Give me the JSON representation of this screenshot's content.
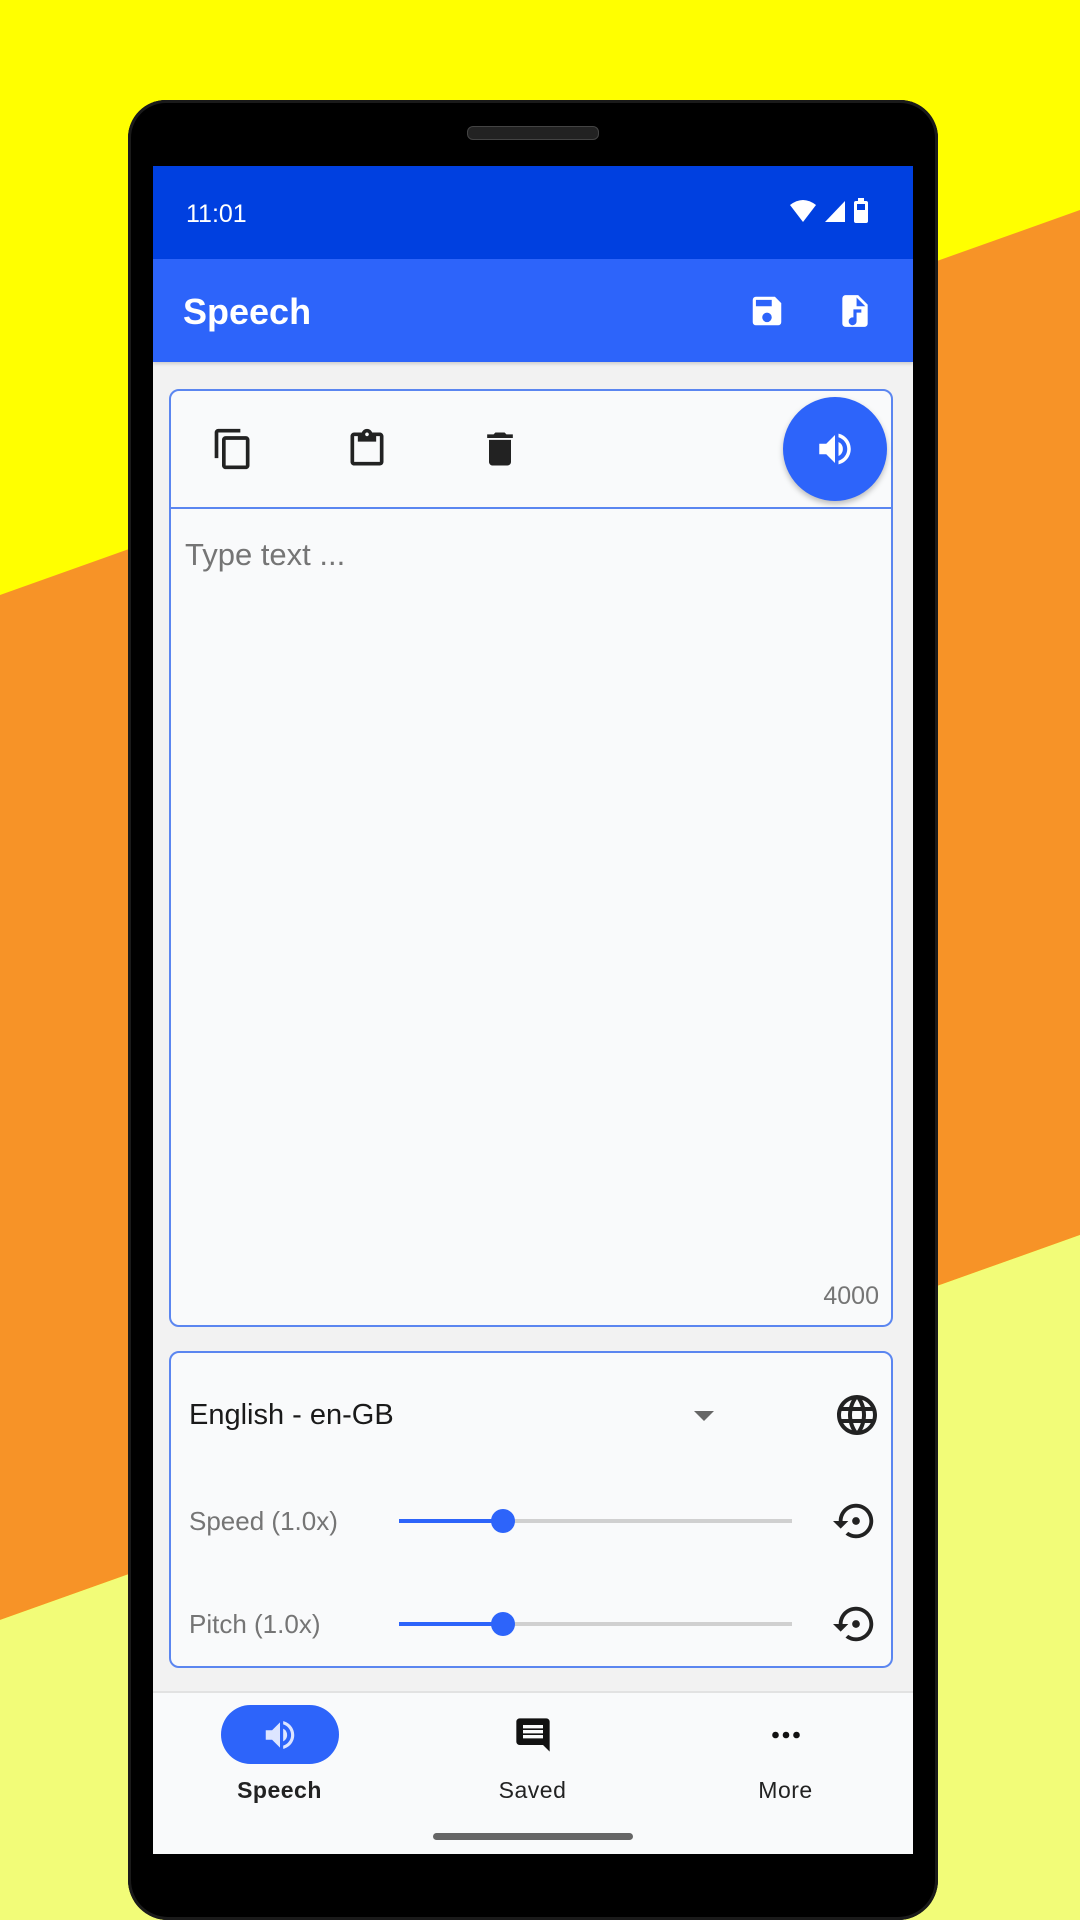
{
  "status_bar": {
    "time": "11:01",
    "icons": [
      "wifi-icon",
      "cellular-signal-icon",
      "battery-charging-icon"
    ]
  },
  "app_bar": {
    "title": "Speech",
    "actions": [
      {
        "name": "save-icon",
        "label": "Save"
      },
      {
        "name": "audio-file-icon",
        "label": "Export audio file"
      }
    ]
  },
  "text_card": {
    "toolbar": [
      {
        "name": "copy-icon",
        "label": "Copy"
      },
      {
        "name": "paste-icon",
        "label": "Paste"
      },
      {
        "name": "delete-icon",
        "label": "Clear"
      }
    ],
    "speak_button_icon": "volume-up-icon",
    "text_value": "",
    "placeholder": "Type text ...",
    "char_counter": "4000"
  },
  "voice_settings": {
    "language": {
      "selected": "English - en-GB",
      "icon": "globe-icon"
    },
    "speed": {
      "label": "Speed (1.0x)",
      "value": 1.0,
      "position_fraction": 0.265,
      "reset_icon": "restore-icon"
    },
    "pitch": {
      "label": "Pitch (1.0x)",
      "value": 1.0,
      "position_fraction": 0.265,
      "reset_icon": "restore-icon"
    }
  },
  "bottom_nav": {
    "items": [
      {
        "label": "Speech",
        "icon": "volume-up-icon",
        "active": true
      },
      {
        "label": "Saved",
        "icon": "chat-message-icon",
        "active": false
      },
      {
        "label": "More",
        "icon": "more-horizontal-icon",
        "active": false
      }
    ]
  },
  "colors": {
    "status_bar": "#0040E0",
    "primary": "#2D64FA",
    "card_border": "#5B86F0",
    "background_yellow": "#FFFF00",
    "background_orange": "#F79327",
    "background_light_yellow": "#F2FC78"
  }
}
